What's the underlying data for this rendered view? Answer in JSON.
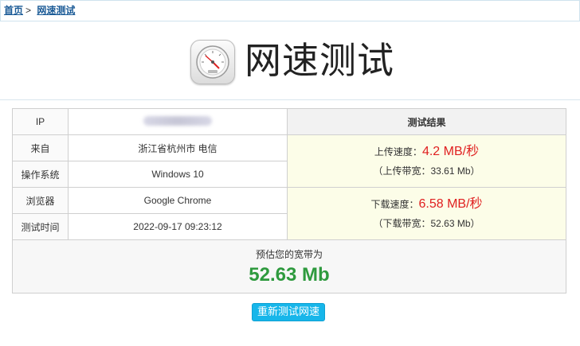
{
  "breadcrumb": {
    "home": "首页",
    "separator": ">",
    "current": "网速测试"
  },
  "header": {
    "title": "网速测试",
    "logo_icon": "speedometer-icon"
  },
  "info_table": {
    "rows": [
      {
        "label": "IP",
        "value": ""
      },
      {
        "label": "来自",
        "value": "浙江省杭州市 电信"
      },
      {
        "label": "操作系统",
        "value": "Windows 10"
      },
      {
        "label": "浏览器",
        "value": "Google Chrome"
      },
      {
        "label": "测试时间",
        "value": "2022-09-17 09:23:12"
      }
    ],
    "result_header": "测试结果",
    "upload": {
      "label": "上传速度：",
      "speed": "4.2 MB/秒",
      "bandwidth": "（上传带宽：33.61 Mb）"
    },
    "download": {
      "label": "下载速度：",
      "speed": "6.58 MB/秒",
      "bandwidth": "（下载带宽：52.63 Mb）"
    },
    "bandwidth_label": "预估您的宽带为",
    "bandwidth_value": "52.63 Mb"
  },
  "retest_button": "重新测试网速",
  "colors": {
    "link": "#1a5a96",
    "speed": "#e02020",
    "bandwidth": "#2e9a3e",
    "button": "#17b6ea"
  }
}
